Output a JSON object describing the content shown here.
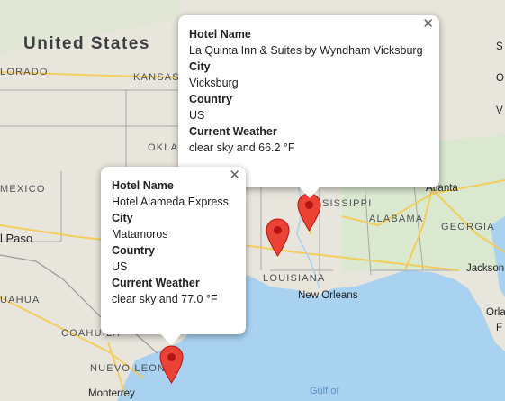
{
  "map": {
    "labels": {
      "united_states": "United States",
      "kansas": "KANSAS",
      "oklahoma": "OKLA",
      "colorado": "LORADO",
      "mexico_state": "MEXICO",
      "mississippi": "SISSIPPI",
      "alabama": "ALABAMA",
      "georgia": "GEORGIA",
      "louisiana": "LOUISIANA",
      "coahuila": "COAHUILA",
      "chihuahua": "UAHUA",
      "nuevo_leon": "NUEVO LEON",
      "el_paso": "l Paso",
      "atlanta": "Atlanta",
      "jackson": "Jackson",
      "new_orleans": "New Orleans",
      "orlando": "Orla",
      "monterrey": "Monterrey",
      "gulf_of_mexico": "Gulf of",
      "right_edge_s": "S",
      "right_edge_o": "O",
      "right_edge_f": "F",
      "right_edge_v": "V"
    },
    "colors": {
      "land": "#e8e5dc",
      "water": "#a8d2f0",
      "green": "#cde5c0",
      "highway": "#f7c94a",
      "border": "#9a9a9a",
      "pin": "#ea4335",
      "pin_dark": "#b31412"
    },
    "markers": [
      "vicksburg-marker",
      "second-marker",
      "matamoros-marker"
    ]
  },
  "infowindows": [
    {
      "hotel_name_label": "Hotel Name",
      "hotel_name": "La Quinta Inn & Suites by Wyndham Vicksburg",
      "city_label": "City",
      "city": "Vicksburg",
      "country_label": "Country",
      "country": "US",
      "weather_label": "Current Weather",
      "weather": "clear sky and 66.2 °F",
      "close_icon": "close-icon"
    },
    {
      "hotel_name_label": "Hotel Name",
      "hotel_name": "Hotel Alameda Express",
      "city_label": "City",
      "city": "Matamoros",
      "country_label": "Country",
      "country": "US",
      "weather_label": "Current Weather",
      "weather": "clear sky and 77.0 °F",
      "close_icon": "close-icon"
    }
  ]
}
